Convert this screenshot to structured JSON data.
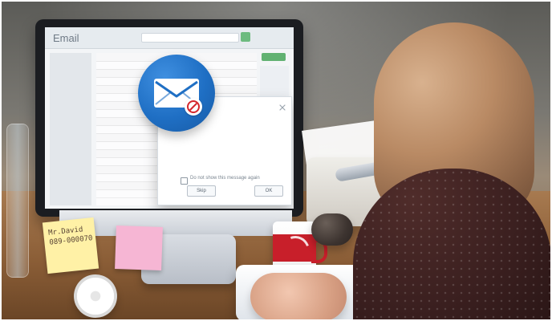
{
  "screen": {
    "app_name": "Email",
    "dialog": {
      "checkbox_label": "Do not show this message again",
      "buttons": [
        "Skip",
        "OK"
      ]
    }
  },
  "sticky_note": {
    "text": "Mr.David\n089-000070"
  },
  "icons": {
    "email": "email-envelope-icon",
    "blocked": "blocked-icon"
  },
  "colors": {
    "mail_blue": "#1f6fc4",
    "block_red": "#d4272d",
    "sticky_yellow": "#fff1a6",
    "sticky_pink": "#f6b6d4",
    "mug_red": "#c81f2a"
  }
}
